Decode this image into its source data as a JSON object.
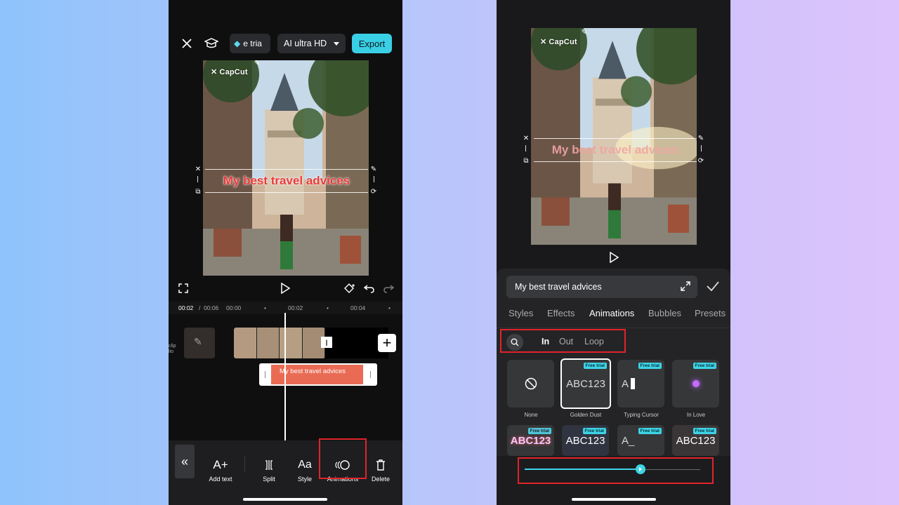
{
  "left": {
    "topbar": {
      "trial_label": "e tria",
      "quality_label": "AI ultra HD",
      "export_label": "Export"
    },
    "watermark": "CapCut",
    "overlay_text": "My best travel advices",
    "timecodes": {
      "current": "00:02",
      "separator": "/",
      "total": "00:06",
      "tick_1": "00:00",
      "tick_2": "00:02",
      "tick_3": "00:04"
    },
    "side_label": [
      "clip",
      "lio"
    ],
    "text_track_label": "My best travel advices",
    "toolbar": [
      {
        "label": "Add text",
        "icon": "add-text-icon"
      },
      {
        "label": "Split",
        "icon": "split-icon"
      },
      {
        "label": "Style",
        "icon": "style-icon"
      },
      {
        "label": "Animations",
        "icon": "animations-icon"
      },
      {
        "label": "Delete",
        "icon": "trash-icon"
      }
    ]
  },
  "right": {
    "watermark": "CapCut",
    "overlay_text": "My best travel advices",
    "input_value": "My best travel advices",
    "tabs": [
      "Styles",
      "Effects",
      "Animations",
      "Bubbles",
      "Presets"
    ],
    "active_tab": "Animations",
    "subtabs": [
      "In",
      "Out",
      "Loop"
    ],
    "active_subtab": "In",
    "badge": "Free trial",
    "cards_row1": [
      {
        "preview": "",
        "label": "None",
        "badge": false
      },
      {
        "preview": "ABC123",
        "label": "Golden Dust",
        "badge": true
      },
      {
        "preview": "A",
        "label": "Typing Cursor",
        "badge": true
      },
      {
        "preview": "",
        "label": "In Love",
        "badge": true
      }
    ],
    "cards_row2": [
      {
        "preview": "ABC123"
      },
      {
        "preview": "ABC123"
      },
      {
        "preview": "A_"
      },
      {
        "preview": "ABC123"
      }
    ],
    "slider_fraction": 0.66
  },
  "colors": {
    "accent": "#39cfe4",
    "highlight": "#e0242a",
    "overlay_text": "#e73a3a",
    "track": "#e96b54"
  }
}
